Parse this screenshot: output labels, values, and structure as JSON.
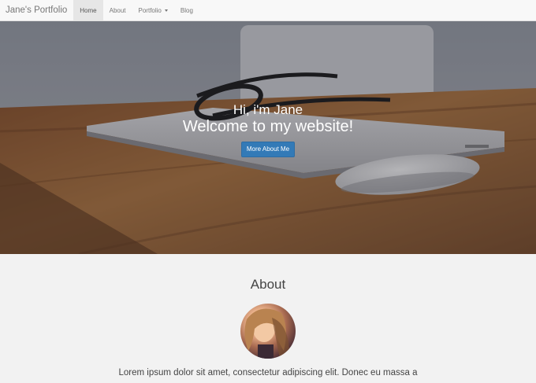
{
  "navbar": {
    "brand": "Jane's Portfolio",
    "items": [
      {
        "label": "Home"
      },
      {
        "label": "About"
      },
      {
        "label": "Portfolio"
      },
      {
        "label": "Blog"
      }
    ]
  },
  "hero": {
    "greeting": "Hi, i'm Jane",
    "welcome": "Welcome to my website!",
    "button_label": "More About Me"
  },
  "about": {
    "title": "About",
    "text": "Lorem ipsum dolor sit amet, consectetur adipiscing elit. Donec eu massa a"
  },
  "colors": {
    "primary_button": "#337ab7",
    "navbar_bg": "#f8f8f8",
    "active_tab_bg": "#e6e6e6"
  }
}
